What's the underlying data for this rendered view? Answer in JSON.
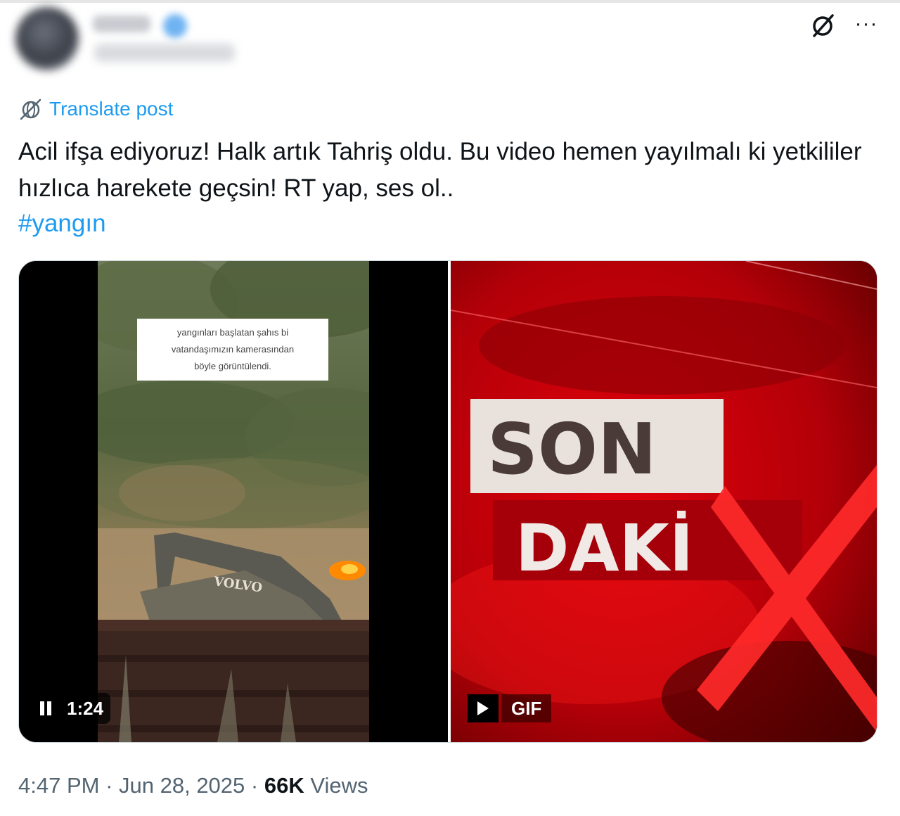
{
  "header": {
    "avatar_icon": "user-avatar-blurred",
    "grok_icon": "slashed-circle-icon",
    "more_icon": "more-options-icon",
    "more_label": "···"
  },
  "translate": {
    "icon": "translate-globe-icon",
    "label": "Translate post"
  },
  "tweet": {
    "text": "Acil ifşa ediyoruz! Halk artık Tahriş oldu. Bu video hemen yayılmalı ki yetkililer hızlıca harekete geçsin! RT yap, ses ol..",
    "hashtag": "#yangın"
  },
  "media": {
    "video": {
      "caption_line1": "yangınları başlatan şahıs bi",
      "caption_line2": "vatandaşımızın kamerasından",
      "caption_line3": "böyle görüntülendi.",
      "vehicle_brand": "VOLVO",
      "pause_icon": "pause-icon",
      "duration": "1:24"
    },
    "gif": {
      "line1": "SON",
      "line2": "DAKİ",
      "play_icon": "play-icon",
      "label": "GIF"
    }
  },
  "footer": {
    "time": "4:47 PM",
    "sep1": " · ",
    "date": "Jun 28, 2025",
    "sep2": " · ",
    "views_count": "66K",
    "views_label": " Views"
  },
  "colors": {
    "link_blue": "#1d9bf0",
    "text": "#0f1419",
    "muted": "#536471",
    "breaking_red": "#c8000a"
  }
}
